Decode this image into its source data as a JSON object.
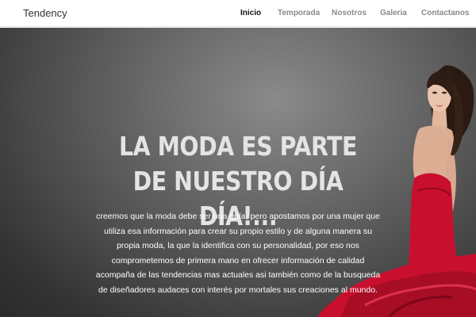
{
  "brand": "Tendency",
  "nav": {
    "items": [
      {
        "label": "Inicio",
        "active": true
      },
      {
        "label": "Temporada",
        "active": false
      },
      {
        "label": "Nosotros",
        "active": false
      },
      {
        "label": "Galeria",
        "active": false
      },
      {
        "label": "Contactanos",
        "active": false
      }
    ]
  },
  "hero": {
    "title": "LA MODA ES PARTE DE NUESTRO DÍA DÍA!...",
    "text": "creemos que la moda debe ser una guía, pero apostamos por una mujer que utiliza esa información para crear su propio estilo y de alguna manera su propia moda, la que la identifica con su personalidad, por eso nos comprometemos de primera mano en ofrecer información de calidad acompaña de las tendencias mas actuales asi también como de la busqueda de diseñadores audaces con interés por mortales sus creaciones al mundo."
  },
  "colors": {
    "hero_bg": "#4d4d4d",
    "dress": "#c8102e",
    "nav_active": "#111111",
    "nav_inactive": "#8a8a8a"
  }
}
